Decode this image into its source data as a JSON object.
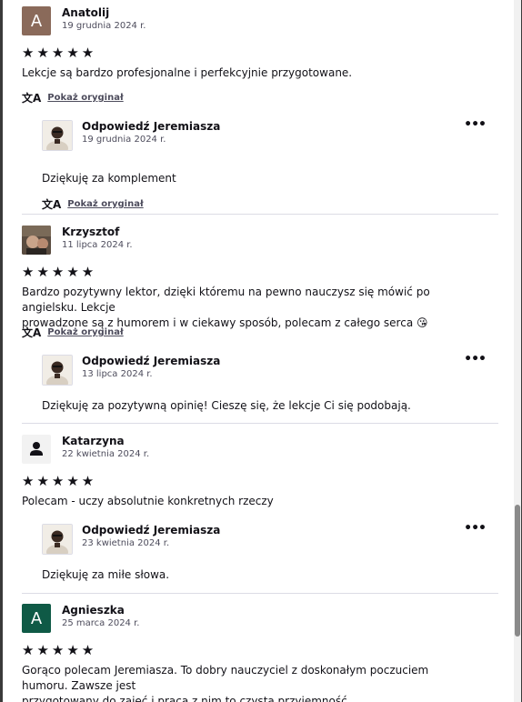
{
  "translate_icon": "translate-icon",
  "show_original": "Pokaż oryginał",
  "more_icon": "•••",
  "stars": "★★★★★",
  "reviews": [
    {
      "initial": "A",
      "avatar_color": "#8a6a5a",
      "name": "Anatolij",
      "date": "19 grudnia 2024 r.",
      "text": "Lekcje są bardzo profesjonalne i perfekcyjnie przygotowane.",
      "reply": {
        "name": "Odpowiedź Jeremiasza",
        "date": "19 grudnia 2024 r.",
        "text": "Dziękuję za komplement"
      }
    },
    {
      "initial": "",
      "avatar_color": "#6b5a4a",
      "name": "Krzysztof",
      "date": "11 lipca 2024 r.",
      "text_line1": "Bardzo pozytywny lektor, dzięki któremu na pewno nauczysz się mówić po angielsku. Lekcje",
      "text_line2": "prowadzone są z humorem i w ciekawy sposób, polecam z całego serca 😘",
      "reply": {
        "name": "Odpowiedź Jeremiasza",
        "date": "13 lipca 2024 r.",
        "text": "Dziękuję za pozytywną opinię! Cieszę się, że lekcje Ci się podobają."
      }
    },
    {
      "initial": "",
      "avatar_color": "#f2f2f2",
      "name": "Katarzyna",
      "date": "22 kwietnia 2024 r.",
      "text": "Polecam - uczy absolutnie konkretnych rzeczy",
      "reply": {
        "name": "Odpowiedź Jeremiasza",
        "date": "23 kwietnia 2024 r.",
        "text": "Dziękuję za miłe słowa."
      }
    },
    {
      "initial": "A",
      "avatar_color": "#0f5a46",
      "name": "Agnieszka",
      "date": "25 marca 2024 r.",
      "text_line1": "Gorąco polecam Jeremiasza. To dobry nauczyciel z doskonałym poczuciem humoru. Zawsze jest",
      "text_line2": "przygotowany do zajęć i praca z nim to czysta przyjemność."
    }
  ]
}
